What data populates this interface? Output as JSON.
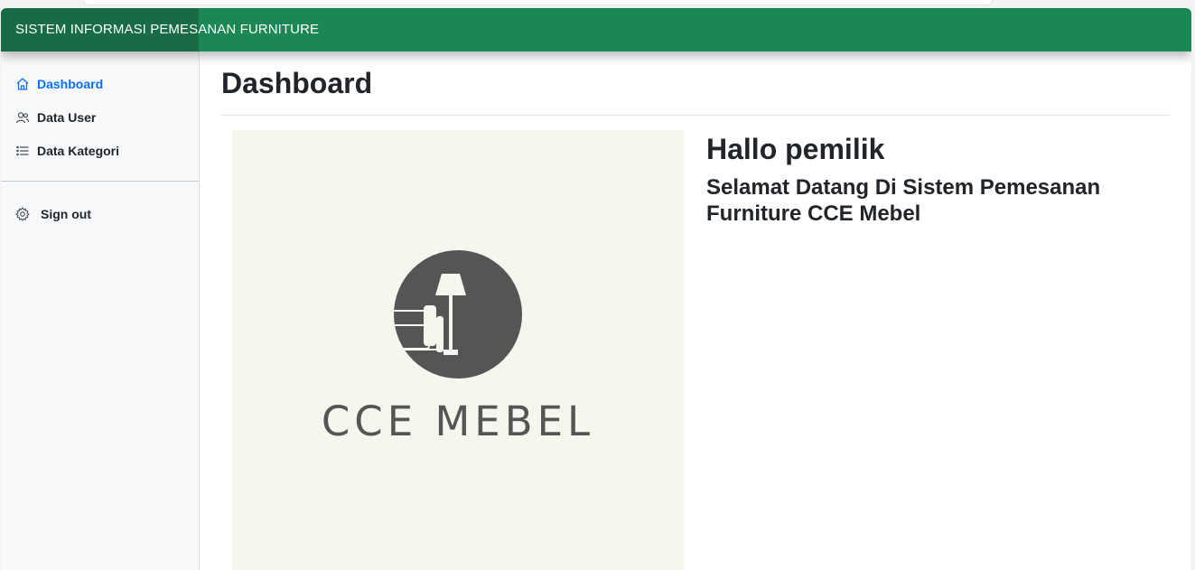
{
  "navbar": {
    "brand": "SISTEM INFORMASI PEMESANAN FURNITURE"
  },
  "sidebar": {
    "items": [
      {
        "label": "Dashboard",
        "icon": "house-icon",
        "active": true
      },
      {
        "label": "Data User",
        "icon": "people-icon",
        "active": false
      },
      {
        "label": "Data Kategori",
        "icon": "list-icon",
        "active": false
      }
    ],
    "signout": {
      "label": "Sign out",
      "icon": "gear-icon"
    }
  },
  "main": {
    "title": "Dashboard",
    "logo": {
      "text": "CCE MEBEL"
    },
    "greeting": "Hallo pemilik",
    "welcome": "Selamat Datang Di Sistem Pemesanan Furniture CCE Mebel"
  },
  "colors": {
    "navbar": "#1b8754",
    "brand_bg": "#176c45",
    "active_link": "#0d6efd",
    "logo_bg": "#f6f6ef",
    "logo_mark": "#555555"
  }
}
